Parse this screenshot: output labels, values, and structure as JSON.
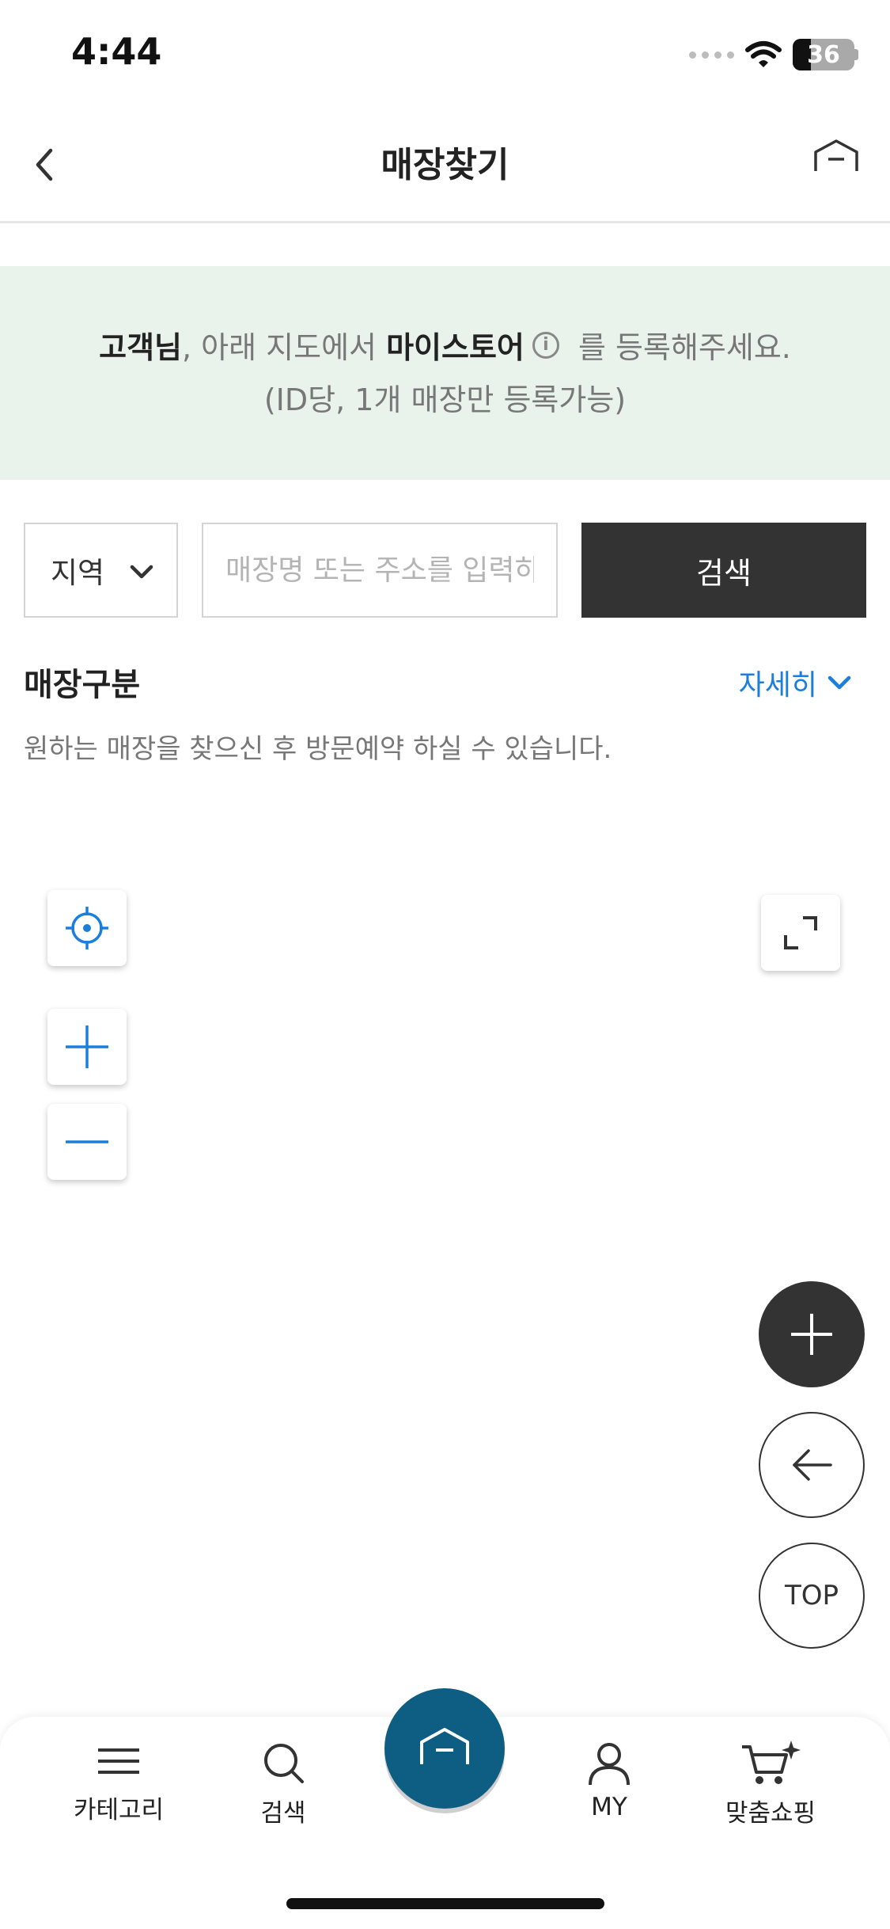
{
  "status_bar": {
    "time": "4:44",
    "battery": "36"
  },
  "header": {
    "title": "매장찾기"
  },
  "notice": {
    "line1_bold1": "고객님",
    "line1_text1": ", 아래 지도에서 ",
    "line1_bold2": "마이스토어",
    "line1_info": "i",
    "line1_text2": " 를 등록해주세요.",
    "line2": "(ID당, 1개 매장만 등록가능)"
  },
  "search": {
    "region_label": "지역",
    "input_placeholder": "매장명 또는 주소를 입력하세요",
    "input_value": "",
    "button_label": "검색"
  },
  "store_type": {
    "title": "매장구분",
    "detail_label": "자세히",
    "description": "원하는 매장을 찾으신 후 방문예약 하실 수 있습니다."
  },
  "floating": {
    "top_label": "TOP"
  },
  "bottom_nav": {
    "category": "카테고리",
    "search": "검색",
    "my": "MY",
    "custom_shopping": "맞춤쇼핑"
  },
  "colors": {
    "accent_blue": "#1a7fdc",
    "notice_bg": "#eaf2ec",
    "search_btn_bg": "#333333",
    "home_btn_bg": "#0e5d82"
  }
}
